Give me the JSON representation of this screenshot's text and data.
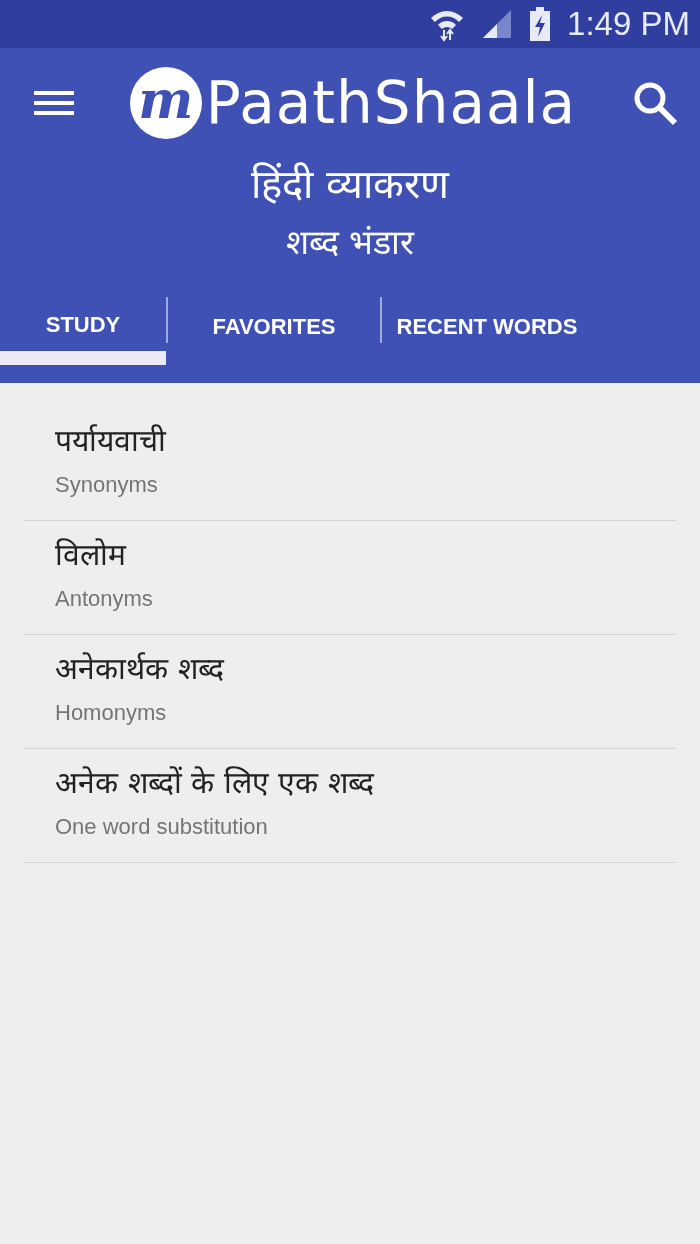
{
  "status_bar": {
    "time": "1:49 PM"
  },
  "app_bar": {
    "logo_mark": "m",
    "logo_text": "PaathShaala",
    "title": "हिंदी व्याकरण",
    "subtitle": "शब्द भंडार"
  },
  "tabs": [
    {
      "label": "STUDY",
      "selected": true
    },
    {
      "label": "FAVORITES",
      "selected": false
    },
    {
      "label": "RECENT WORDS",
      "selected": false
    }
  ],
  "items": [
    {
      "title": "पर्यायवाची",
      "subtitle": "Synonyms"
    },
    {
      "title": "विलोम",
      "subtitle": "Antonyms"
    },
    {
      "title": "अनेकार्थक शब्द",
      "subtitle": "Homonyms"
    },
    {
      "title": "अनेक शब्दों के लिए एक शब्द",
      "subtitle": "One word substitution"
    }
  ]
}
